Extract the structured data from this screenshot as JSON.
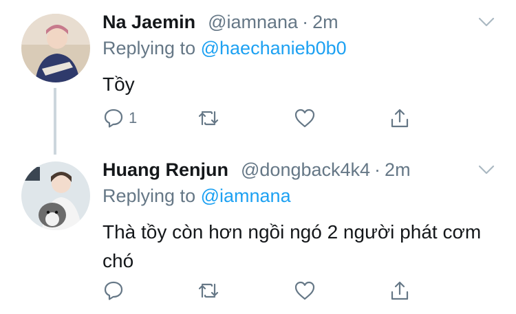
{
  "tweets": [
    {
      "name": "Na Jaemin",
      "handle": "@iamnana",
      "separator": "·",
      "time": "2m",
      "replying_prefix": "Replying to",
      "replying_to": "@haechanieb0b0",
      "text": "Tồy",
      "reply_count": "1",
      "avatar_icon": "user-avatar"
    },
    {
      "name": "Huang Renjun",
      "handle": "@dongback4k4",
      "separator": "·",
      "time": "2m",
      "replying_prefix": "Replying to",
      "replying_to": "@iamnana",
      "text": "Thà tồy còn hơn ngồi ngó 2 người phát cơm chó",
      "reply_count": "",
      "avatar_icon": "user-avatar"
    }
  ],
  "colors": {
    "link": "#1da1f2",
    "muted": "#657786",
    "text": "#14171a",
    "thread_line": "#ccd6dd"
  }
}
